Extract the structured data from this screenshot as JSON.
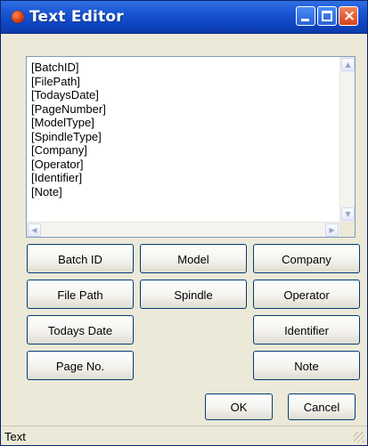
{
  "window": {
    "title": "Text Editor",
    "app_icon": "red-ball-icon",
    "controls": {
      "minimize": "minimize-icon",
      "maximize": "maximize-icon",
      "close": "close-icon"
    }
  },
  "editor": {
    "lines": [
      "[BatchID]",
      "[FilePath]",
      "[TodaysDate]",
      "[PageNumber]",
      "[ModelType]",
      "[SpindleType]",
      "[Company]",
      "[Operator]",
      "[Identifier]",
      "[Note]"
    ],
    "scroll_glyphs": {
      "up": "▲",
      "down": "▼",
      "left": "◀",
      "right": "▶"
    }
  },
  "buttons": {
    "batch_id": "Batch ID",
    "file_path": "File Path",
    "todays_date": "Todays Date",
    "page_no": "Page No.",
    "model": "Model",
    "spindle": "Spindle",
    "company": "Company",
    "operator": "Operator",
    "identifier": "Identifier",
    "note": "Note",
    "ok": "OK",
    "cancel": "Cancel"
  },
  "status": {
    "text": "Text"
  },
  "colors": {
    "title_bar": "#1b57d4",
    "window_bg": "#ece9d8",
    "button_border": "#003c74",
    "close_button": "#d7431a"
  }
}
